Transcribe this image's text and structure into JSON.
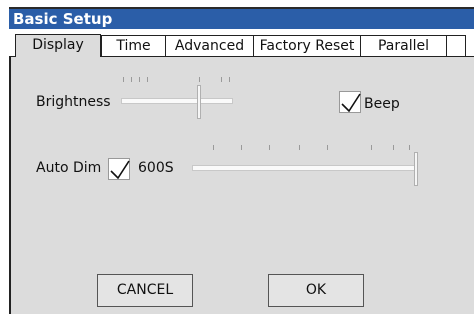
{
  "window": {
    "title": "Basic Setup"
  },
  "tabs": [
    {
      "label": "Display",
      "active": true
    },
    {
      "label": "Time",
      "active": false
    },
    {
      "label": "Advanced",
      "active": false
    },
    {
      "label": "Factory Reset",
      "active": false
    },
    {
      "label": "Parallel",
      "active": false
    }
  ],
  "display": {
    "brightness": {
      "label": "Brightness",
      "level": 0.7
    },
    "beep": {
      "label": "Beep",
      "checked": true
    },
    "auto_dim": {
      "label": "Auto Dim",
      "checked": true,
      "value_text": "600S",
      "level": 1.0
    }
  },
  "buttons": {
    "cancel": "CANCEL",
    "ok": "OK"
  },
  "colors": {
    "title_bar": "#2b5ea8",
    "panel_bg": "#dcdcdc"
  },
  "icons": {
    "checkmark": "checkmark-icon"
  }
}
